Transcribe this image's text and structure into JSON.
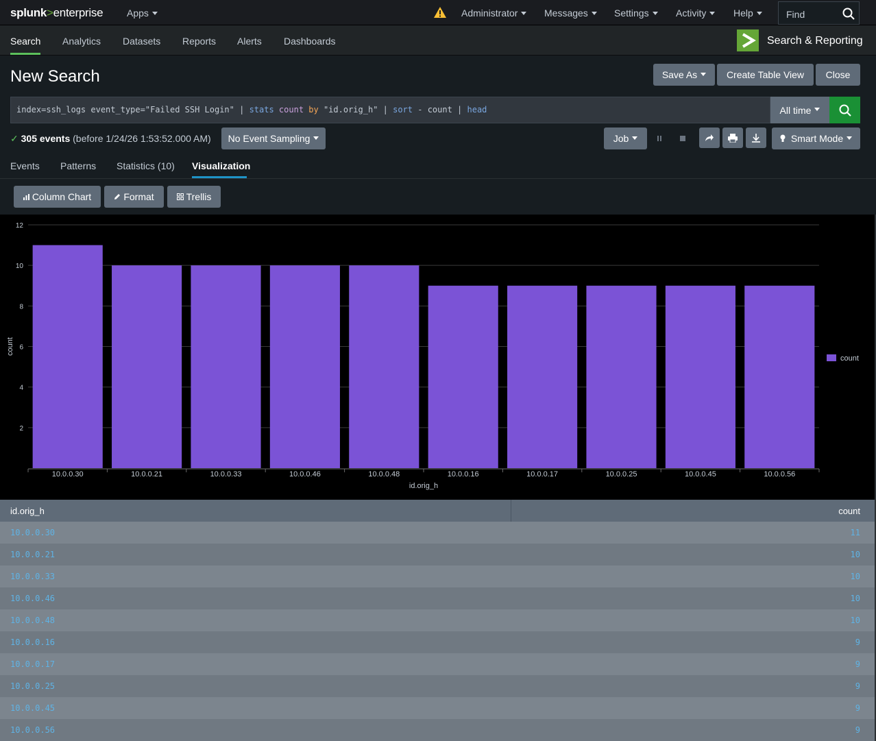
{
  "topbar": {
    "logo_a": "splunk",
    "logo_b": ">",
    "logo_c": "enterprise",
    "apps": "Apps",
    "administrator": "Administrator",
    "messages": "Messages",
    "settings": "Settings",
    "activity": "Activity",
    "help": "Help",
    "find_label": "Find"
  },
  "appbar": {
    "nav": [
      "Search",
      "Analytics",
      "Datasets",
      "Reports",
      "Alerts",
      "Dashboards"
    ],
    "active": "Search",
    "app_title": "Search & Reporting"
  },
  "page": {
    "title": "New Search",
    "save_as": "Save As",
    "create_table_view": "Create Table View",
    "close": "Close"
  },
  "search": {
    "query_parts": {
      "p1": "index=ssh_logs event_type=\"Failed SSH Login\" | ",
      "p2": "stats",
      "p3": " ",
      "p4": "count",
      "p5": " ",
      "p6": "by",
      "p7": " \"id.orig_h\" | ",
      "p8": "sort",
      "p9": " - count | ",
      "p10": "head"
    },
    "time_range": "All time"
  },
  "status": {
    "check": "✓",
    "events": "305 events",
    "before": "(before 1/24/26 1:53:52.000 AM)",
    "sampling": "No Event Sampling",
    "job": "Job",
    "mode": "Smart Mode"
  },
  "tabs": [
    "Events",
    "Patterns",
    "Statistics (10)",
    "Visualization"
  ],
  "active_tab": "Visualization",
  "viz_toolbar": {
    "column_chart": "Column Chart",
    "format": "Format",
    "trellis": "Trellis"
  },
  "colors": {
    "bar": "#7b53d6",
    "accent_green": "#5cc05c",
    "link_blue": "#5fb3e5"
  },
  "chart_data": {
    "type": "bar",
    "categories": [
      "10.0.0.30",
      "10.0.0.21",
      "10.0.0.33",
      "10.0.0.46",
      "10.0.0.48",
      "10.0.0.16",
      "10.0.0.17",
      "10.0.0.25",
      "10.0.0.45",
      "10.0.0.56"
    ],
    "series": [
      {
        "name": "count",
        "values": [
          11,
          10,
          10,
          10,
          10,
          9,
          9,
          9,
          9,
          9
        ]
      }
    ],
    "xlabel": "id.orig_h",
    "ylabel": "count",
    "ylim": [
      0,
      12
    ],
    "yticks": [
      2,
      4,
      6,
      8,
      10,
      12
    ],
    "grid": true,
    "legend": "right"
  },
  "table": {
    "columns": [
      "id.orig_h",
      "count"
    ],
    "rows": [
      [
        "10.0.0.30",
        "11"
      ],
      [
        "10.0.0.21",
        "10"
      ],
      [
        "10.0.0.33",
        "10"
      ],
      [
        "10.0.0.46",
        "10"
      ],
      [
        "10.0.0.48",
        "10"
      ],
      [
        "10.0.0.16",
        "9"
      ],
      [
        "10.0.0.17",
        "9"
      ],
      [
        "10.0.0.25",
        "9"
      ],
      [
        "10.0.0.45",
        "9"
      ],
      [
        "10.0.0.56",
        "9"
      ]
    ]
  }
}
